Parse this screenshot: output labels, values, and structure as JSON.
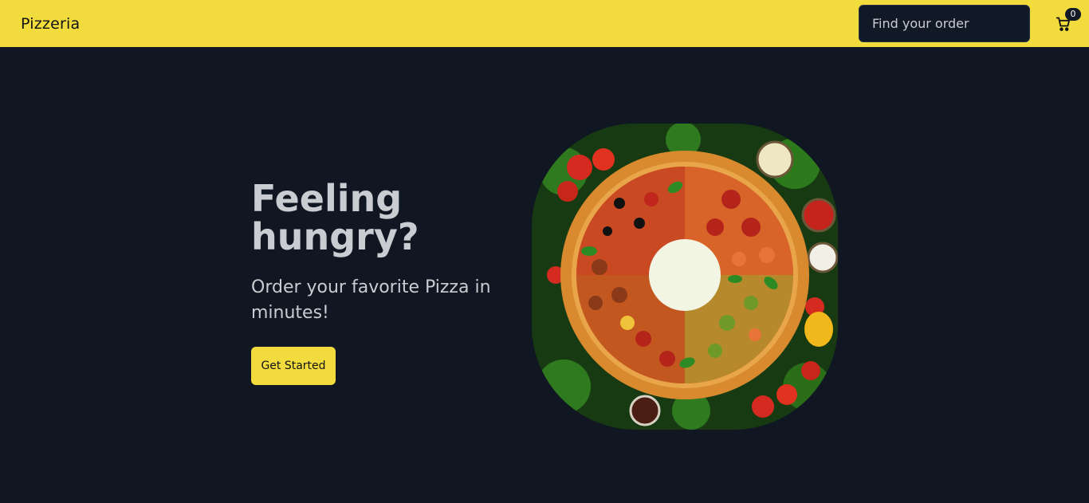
{
  "navbar": {
    "brand": "Pizzeria",
    "search_placeholder": "Find your order",
    "cart_icon": "cart-icon",
    "cart_count": "0"
  },
  "hero": {
    "title": "Feeling hungry?",
    "subtitle": "Order your favorite Pizza in minutes!",
    "cta_label": "Get Started"
  },
  "colors": {
    "accent": "#f2dc3d",
    "background": "#101722",
    "text": "#c9cdd2"
  }
}
